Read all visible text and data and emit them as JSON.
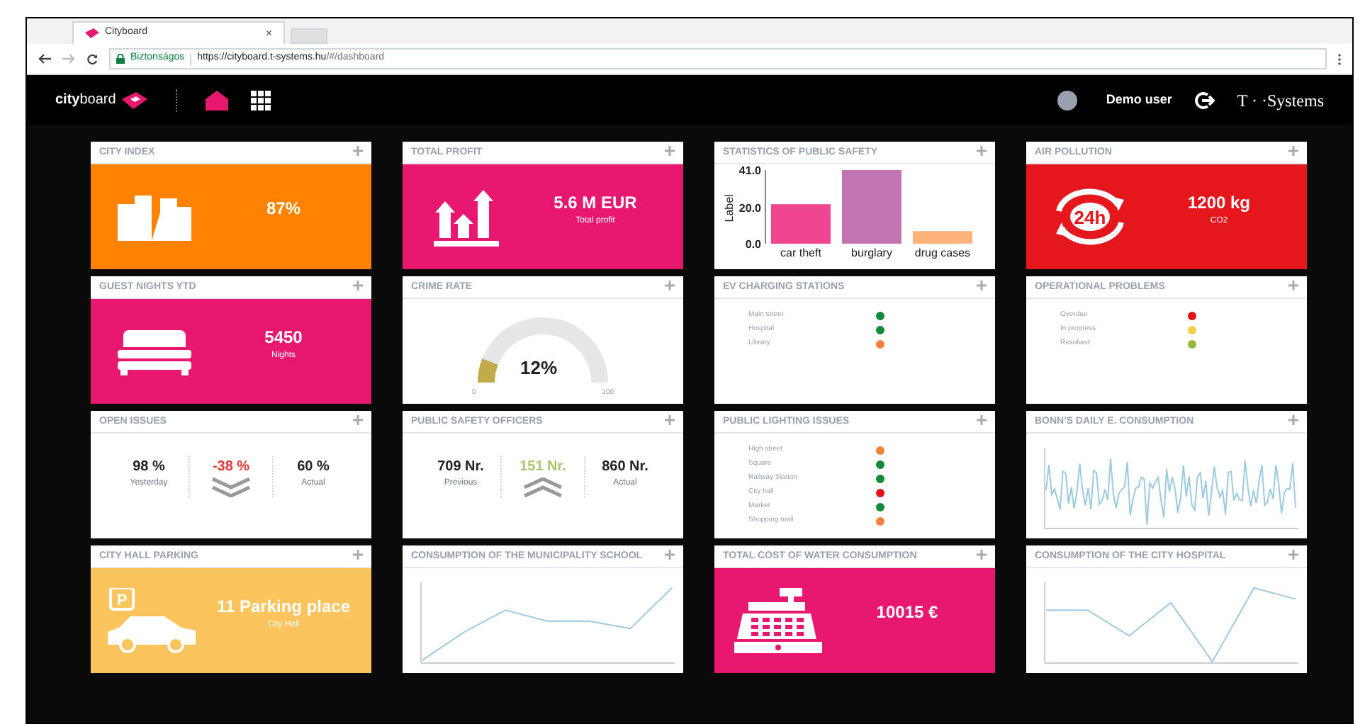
{
  "browser": {
    "tab_title": "Cityboard",
    "tab_close": "×",
    "secure_label": "Biztonságos",
    "url_host": "https://cityboard.t-systems.hu",
    "url_path": "/#/dashboard"
  },
  "app": {
    "logo_bold": "city",
    "logo_light": "board",
    "user": "Demo user",
    "brand": "T · ·Systems"
  },
  "tiles": [
    {
      "kind": "stat",
      "title": "CITY INDEX",
      "color": "#ff8200",
      "value": "87%"
    },
    {
      "kind": "stat",
      "title": "TOTAL PROFIT",
      "color": "#e8176f",
      "value": "5.6 M EUR",
      "caption": "Total profit"
    },
    {
      "kind": "bars",
      "title": "STATISTICS OF PUBLIC SAFETY",
      "chart_data": {
        "type": "bar",
        "ylabel": "Label",
        "categories": [
          "car theft",
          "burglary",
          "drug cases"
        ],
        "series": [
          {
            "color": "#f0458f",
            "values": [
              22,
              null,
              null
            ]
          },
          {
            "color": "#c275b0",
            "values": [
              null,
              41,
              null
            ]
          },
          {
            "color": "#fdb27a",
            "values": [
              null,
              null,
              7
            ]
          }
        ],
        "ylim": [
          0,
          41
        ],
        "yticks": [
          {
            "value": 0,
            "label": "0.0"
          },
          {
            "value": 20,
            "label": "20.0"
          },
          {
            "value": 41,
            "label": "41.0"
          }
        ]
      }
    },
    {
      "kind": "stat",
      "title": "AIR POLLUTION",
      "color": "#e5161c",
      "icon_text": "24h",
      "value": "1200 kg",
      "caption": "CO2"
    },
    {
      "kind": "stat",
      "title": "GUEST NIGHTS YTD",
      "color": "#e8176f",
      "value": "5450",
      "caption": "Nights"
    },
    {
      "kind": "gauge",
      "title": "CRIME RATE",
      "level": 0.12,
      "value": "12%",
      "min": "0",
      "max": "100"
    },
    {
      "kind": "list",
      "title": "EV CHARGING STATIONS",
      "items": [
        {
          "label": "Main street",
          "color": "#118a3a"
        },
        {
          "label": "Hospital",
          "color": "#118a3a"
        },
        {
          "label": "Library",
          "color": "#f7803b"
        }
      ]
    },
    {
      "kind": "list",
      "title": "OPERATIONAL PROBLEMS",
      "items": [
        {
          "label": "Overdue",
          "color": "#e2141b"
        },
        {
          "label": "In progress",
          "color": "#f2d04a"
        },
        {
          "label": "Resolved",
          "color": "#94b83a"
        }
      ]
    },
    {
      "kind": "compare",
      "title": "OPEN ISSUES",
      "left": {
        "value": "98 %",
        "label": "Yesterday"
      },
      "middle": {
        "value": "-38 %",
        "increase": false
      },
      "right": {
        "value": "60 %",
        "label": "Actual"
      }
    },
    {
      "kind": "compare",
      "title": "PUBLIC SAFETY OFFICERS",
      "left": {
        "value": "709 Nr.",
        "label": "Previous"
      },
      "middle": {
        "value": "151 Nr.",
        "increase": true
      },
      "right": {
        "value": "860 Nr.",
        "label": "Actual"
      }
    },
    {
      "kind": "list",
      "title": "PUBLIC LIGHTING ISSUES",
      "items": [
        {
          "label": "High street",
          "color": "#f7803b"
        },
        {
          "label": "Square",
          "color": "#118a3a"
        },
        {
          "label": "Railway Station",
          "color": "#118a3a"
        },
        {
          "label": "City hall",
          "color": "#e2141b"
        },
        {
          "label": "Market",
          "color": "#118a3a"
        },
        {
          "label": "Shopping mall",
          "color": "#f7803b"
        }
      ]
    },
    {
      "kind": "line",
      "title": "BONN'S DAILY E. CONSUMPTION"
    },
    {
      "kind": "stat",
      "title": "CITY HALL PARKING",
      "color": "#fcc45c",
      "icon_text": "P",
      "value": "11 Parking place",
      "caption": "City Hall"
    },
    {
      "kind": "line",
      "title": "CONSUMPTION OF THE MUNICIPALITY SCHOOL"
    },
    {
      "kind": "stat",
      "title": "TOTAL COST OF WATER CONSUMPTION",
      "color": "#e8176f",
      "value": "10015 €"
    },
    {
      "kind": "line",
      "title": "CONSUMPTION OF THE CITY HOSPITAL"
    }
  ]
}
